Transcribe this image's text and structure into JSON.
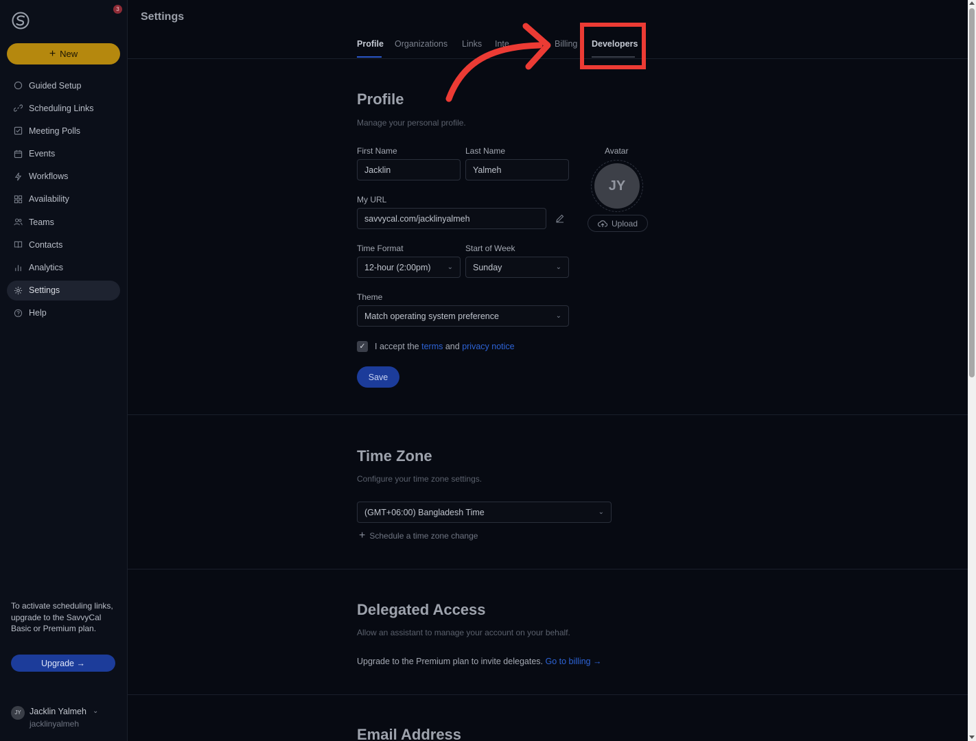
{
  "sidebar": {
    "notification_count": "3",
    "new_button": "New",
    "nav": [
      {
        "label": "Guided Setup",
        "icon": "circle-icon"
      },
      {
        "label": "Scheduling Links",
        "icon": "link-icon"
      },
      {
        "label": "Meeting Polls",
        "icon": "poll-icon"
      },
      {
        "label": "Events",
        "icon": "calendar-icon"
      },
      {
        "label": "Workflows",
        "icon": "bolt-icon"
      },
      {
        "label": "Availability",
        "icon": "grid-icon"
      },
      {
        "label": "Teams",
        "icon": "users-icon"
      },
      {
        "label": "Contacts",
        "icon": "book-icon"
      },
      {
        "label": "Analytics",
        "icon": "bar-chart-icon"
      },
      {
        "label": "Settings",
        "icon": "gear-icon"
      },
      {
        "label": "Help",
        "icon": "help-icon"
      }
    ],
    "upgrade_text": "To activate scheduling links, upgrade to the SavvyCal Basic or Premium plan.",
    "upgrade_button": "Upgrade →",
    "user": {
      "initials": "JY",
      "name": "Jacklin Yalmeh",
      "handle": "jacklinyalmeh"
    }
  },
  "header": {
    "title": "Settings",
    "tabs": [
      "Profile",
      "Organizations",
      "Links",
      "Inte",
      "Billing",
      "Developers"
    ]
  },
  "profile": {
    "heading": "Profile",
    "subtitle": "Manage your personal profile.",
    "first_name_label": "First Name",
    "first_name": "Jacklin",
    "last_name_label": "Last Name",
    "last_name": "Yalmeh",
    "url_label": "My URL",
    "url": "savvycal.com/jacklinyalmeh",
    "time_format_label": "Time Format",
    "time_format": "12-hour (2:00pm)",
    "week_start_label": "Start of Week",
    "week_start": "Sunday",
    "theme_label": "Theme",
    "theme": "Match operating system preference",
    "avatar_label": "Avatar",
    "avatar_initials": "JY",
    "upload_label": "Upload",
    "accept_prefix": "I accept the",
    "terms_link": "terms",
    "accept_and": "and",
    "privacy_link": "privacy notice",
    "save_button": "Save"
  },
  "time_zone": {
    "heading": "Time Zone",
    "subtitle": "Configure your time zone settings.",
    "value": "(GMT+06:00) Bangladesh Time",
    "schedule_change": "Schedule a time zone change"
  },
  "delegated": {
    "heading": "Delegated Access",
    "subtitle": "Allow an assistant to manage your account on your behalf.",
    "note": "Upgrade to the Premium plan to invite delegates.",
    "billing_link": "Go to billing →"
  },
  "email": {
    "heading": "Email Address"
  },
  "colors": {
    "accent": "#2b57c9",
    "new_button": "#b5880e",
    "annotation": "#ec3b34"
  }
}
